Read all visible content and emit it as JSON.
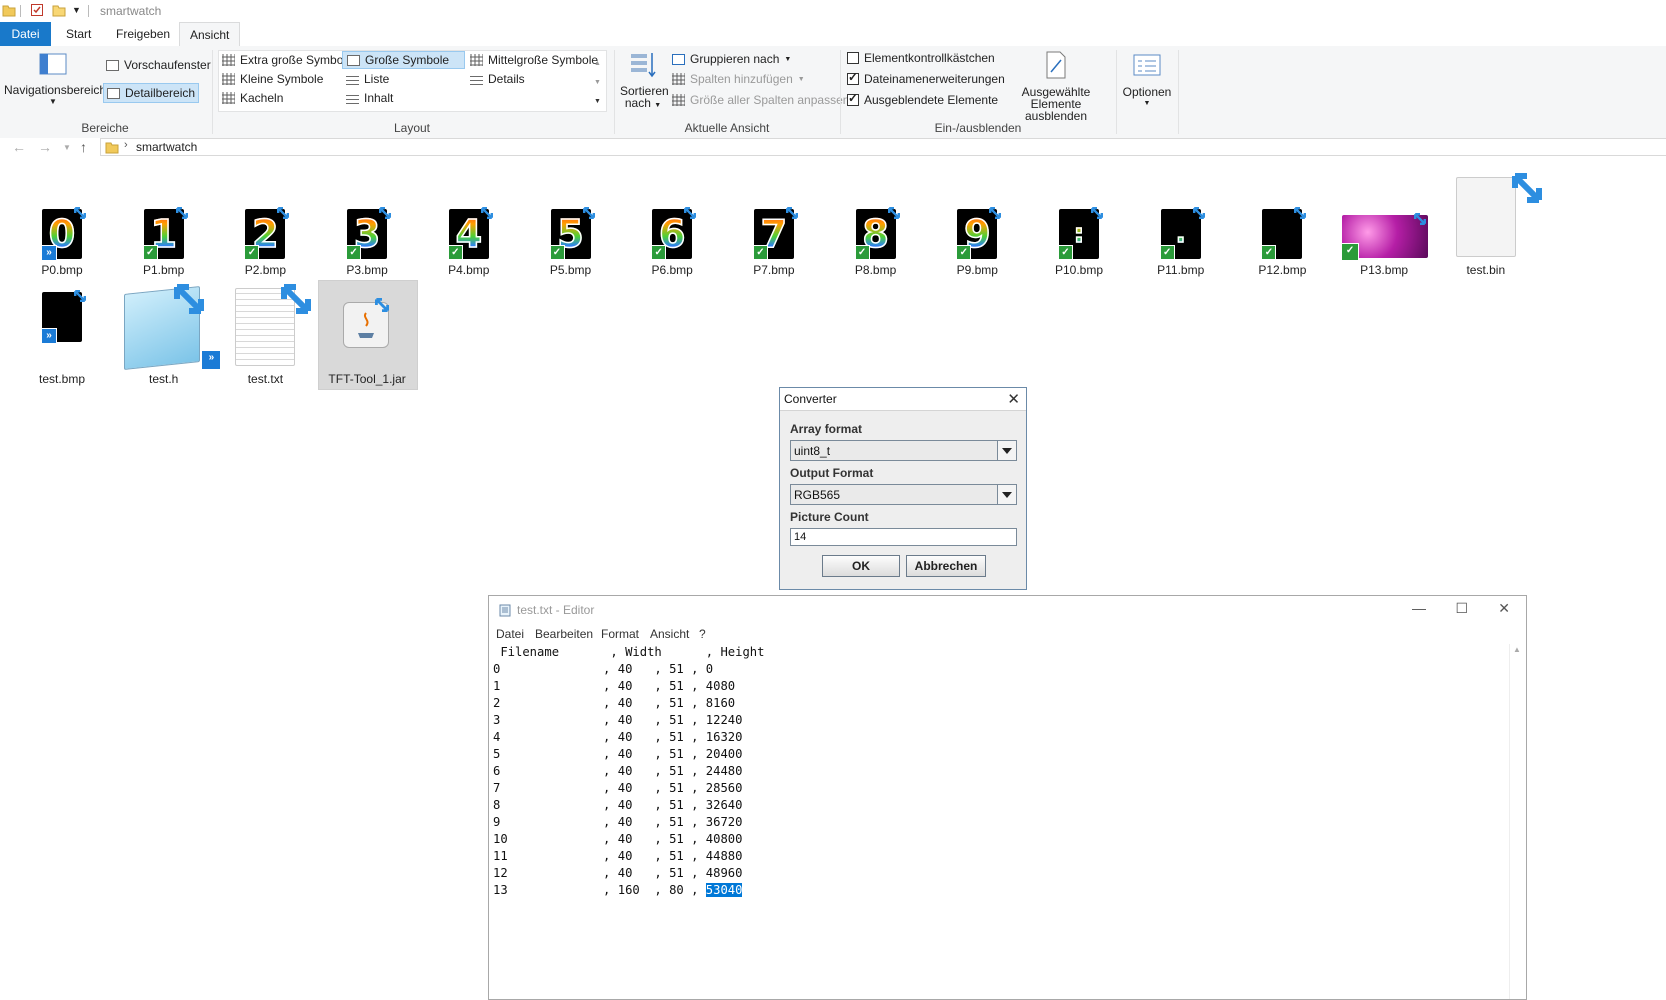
{
  "window": {
    "title": "smartwatch"
  },
  "tabs": [
    {
      "label": "Datei"
    },
    {
      "label": "Start"
    },
    {
      "label": "Freigeben"
    },
    {
      "label": "Ansicht"
    }
  ],
  "ribbon": {
    "bereiche": {
      "navigation_label": "Navigationsbereich",
      "preview_label": "Vorschaufenster",
      "details_label": "Detailbereich",
      "group_label": "Bereiche"
    },
    "layout": {
      "items": [
        "Extra große Symbole",
        "Große Symbole",
        "Mittelgroße Symbole",
        "Kleine Symbole",
        "Liste",
        "Details",
        "Kacheln",
        "Inhalt"
      ],
      "group_label": "Layout"
    },
    "aktuelle_ansicht": {
      "sort_label_1": "Sortieren",
      "sort_label_2": "nach",
      "group_by": "Gruppieren nach",
      "add_columns": "Spalten hinzufügen",
      "fit_columns": "Größe aller Spalten anpassen",
      "group_label": "Aktuelle Ansicht"
    },
    "ein_ausblenden": {
      "item_checkboxes": "Elementkontrollkästchen",
      "extensions": "Dateinamenerweiterungen",
      "hidden_items": "Ausgeblendete Elemente",
      "hide_selected_1": "Ausgewählte",
      "hide_selected_2": "Elemente ausblenden",
      "group_label": "Ein-/ausblenden"
    },
    "options_label": "Optionen"
  },
  "address": {
    "path": "smartwatch"
  },
  "files": [
    {
      "name": "P0.bmp",
      "digit": "0"
    },
    {
      "name": "P1.bmp",
      "digit": "1"
    },
    {
      "name": "P2.bmp",
      "digit": "2"
    },
    {
      "name": "P3.bmp",
      "digit": "3"
    },
    {
      "name": "P4.bmp",
      "digit": "4"
    },
    {
      "name": "P5.bmp",
      "digit": "5"
    },
    {
      "name": "P6.bmp",
      "digit": "6"
    },
    {
      "name": "P7.bmp",
      "digit": "7"
    },
    {
      "name": "P8.bmp",
      "digit": "8"
    },
    {
      "name": "P9.bmp",
      "digit": "9"
    },
    {
      "name": "P10.bmp",
      "digit": ":"
    },
    {
      "name": "P11.bmp",
      "digit": "."
    },
    {
      "name": "P12.bmp",
      "digit": ""
    },
    {
      "name": "P13.bmp",
      "digit": ""
    },
    {
      "name": "test.bin",
      "digit": ""
    },
    {
      "name": "test.bmp",
      "digit": ""
    },
    {
      "name": "test.h",
      "digit": ""
    },
    {
      "name": "test.txt",
      "digit": ""
    },
    {
      "name": "TFT-Tool_1.jar",
      "digit": ""
    }
  ],
  "converter": {
    "title": "Converter",
    "array_format_label": "Array format",
    "array_format_value": "uint8_t",
    "output_format_label": "Output Format",
    "output_format_value": "RGB565",
    "picture_count_label": "Picture Count",
    "picture_count_value": "14",
    "ok_label": "OK",
    "cancel_label": "Abbrechen"
  },
  "editor": {
    "title": "test.txt - Editor",
    "menu": [
      "Datei",
      "Bearbeiten",
      "Format",
      "Ansicht",
      "?"
    ],
    "header": " Filename       , Width      , Height",
    "rows": [
      {
        "name": "0",
        "width": "40",
        "height": "51",
        "offset": "0"
      },
      {
        "name": "1",
        "width": "40",
        "height": "51",
        "offset": "4080"
      },
      {
        "name": "2",
        "width": "40",
        "height": "51",
        "offset": "8160"
      },
      {
        "name": "3",
        "width": "40",
        "height": "51",
        "offset": "12240"
      },
      {
        "name": "4",
        "width": "40",
        "height": "51",
        "offset": "16320"
      },
      {
        "name": "5",
        "width": "40",
        "height": "51",
        "offset": "20400"
      },
      {
        "name": "6",
        "width": "40",
        "height": "51",
        "offset": "24480"
      },
      {
        "name": "7",
        "width": "40",
        "height": "51",
        "offset": "28560"
      },
      {
        "name": "8",
        "width": "40",
        "height": "51",
        "offset": "32640"
      },
      {
        "name": "9",
        "width": "40",
        "height": "51",
        "offset": "36720"
      },
      {
        "name": "10",
        "width": "40",
        "height": "51",
        "offset": "40800"
      },
      {
        "name": "11",
        "width": "40",
        "height": "51",
        "offset": "44880"
      },
      {
        "name": "12",
        "width": "40",
        "height": "51",
        "offset": "48960"
      },
      {
        "name": "13",
        "width": "160",
        "height": "80",
        "offset": "53040"
      }
    ],
    "selected_text": "53040"
  },
  "colors": {
    "accent": "#1979ca",
    "selection": "#0078d7",
    "ribbon_bg": "#f5f6f7"
  }
}
